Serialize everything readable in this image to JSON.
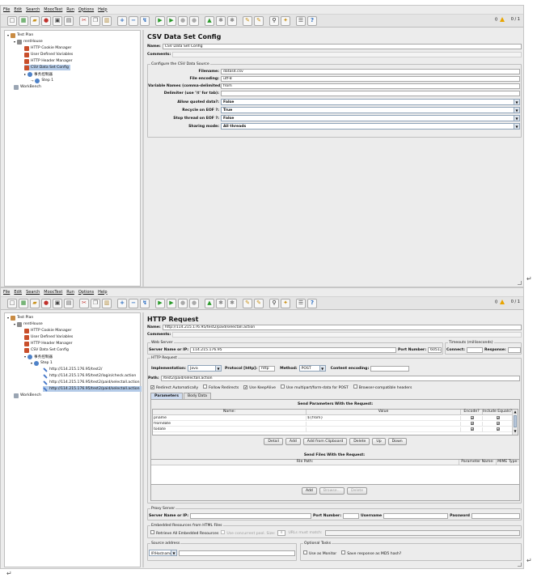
{
  "menu": [
    "File",
    "Edit",
    "Search",
    "MoocTest",
    "Run",
    "Options",
    "Help"
  ],
  "toolbar": {
    "warn_count": "0",
    "threads": "0 / 1"
  },
  "top": {
    "tree": {
      "test_plan": "Test Plan",
      "thread_group": "rentHouse",
      "cookie": "HTTP Cookie Manager",
      "udv": "User Defined Variables",
      "header": "HTTP Header Manager",
      "csv": "CSV Data Set Config",
      "ctrl": "事务控制器",
      "step": "Step 1",
      "workbench": "WorkBench"
    },
    "panel": {
      "title": "CSV Data Set Config",
      "name_label": "Name:",
      "name_value": "CSV Data Set Config",
      "comments_label": "Comments:",
      "group_title": "Configure the CSV Data Source",
      "fields": [
        {
          "label": "Filename:",
          "value": "datas4.csv"
        },
        {
          "label": "File encoding:",
          "value": "utf-8"
        },
        {
          "label": "Variable Names (comma-delimited):",
          "value": "from"
        },
        {
          "label": "Delimiter (use '\\t' for tab):",
          "value": ""
        }
      ],
      "selects": [
        {
          "label": "Allow quoted data?:",
          "value": "False"
        },
        {
          "label": "Recycle on EOF ?:",
          "value": "True"
        },
        {
          "label": "Stop thread on EOF ?:",
          "value": "False"
        },
        {
          "label": "Sharing mode:",
          "value": "All threads"
        }
      ]
    }
  },
  "bottom": {
    "tree": {
      "test_plan": "Test Plan",
      "thread_group": "rentHouse",
      "cookie": "HTTP Cookie Manager",
      "udv": "User Defined Variables",
      "header": "HTTP Header Manager",
      "csv": "CSV Data Set Config",
      "ctrl": "事务控制器",
      "step": "Step 1",
      "samplers": [
        "http://114.215.176.95/test2/",
        "http://114.215.176.95/test2/login/check.action",
        "http://114.215.176.95/test2/paid/selectall.action",
        "http://114.215.176.95/test2/paid/selectall.action"
      ],
      "workbench": "WorkBench"
    },
    "panel": {
      "title": "HTTP Request",
      "name_label": "Name:",
      "name_value": "http://114.215.176.95/test2/paid/selectall.action",
      "comments_label": "Comments:",
      "web_server_title": "Web Server",
      "server_label": "Server Name or IP:",
      "server_value": "114.215.176.95",
      "port_label": "Port Number:",
      "port_value": "60513",
      "timeouts_title": "Timeouts (milliseconds)",
      "connect_label": "Connect:",
      "response_label": "Response:",
      "http_request_title": "HTTP Request",
      "impl_label": "Implementation:",
      "impl_value": "Java",
      "protocol_label": "Protocol [http]:",
      "protocol_value": "http",
      "method_label": "Method:",
      "method_value": "POST",
      "encoding_label": "Content encoding:",
      "path_label": "Path:",
      "path_value": "/test2/paid/selectall.action",
      "checkboxes": [
        {
          "label": "Redirect Automatically",
          "checked": "✔"
        },
        {
          "label": "Follow Redirects",
          "checked": ""
        },
        {
          "label": "Use KeepAlive",
          "checked": "✔"
        },
        {
          "label": "Use multipart/form-data for POST",
          "checked": ""
        },
        {
          "label": "Browser-compatible headers",
          "checked": ""
        }
      ],
      "tabs": [
        "Parameters",
        "Body Data"
      ],
      "params_title": "Send Parameters With the Request:",
      "params_headers": [
        "Name:",
        "Value",
        "Encode?",
        "Include Equals?"
      ],
      "params_rows": [
        {
          "name": "pname",
          "value": "${from}",
          "encode": "✔",
          "equals": "✔"
        },
        {
          "name": "fromdate",
          "value": "",
          "encode": "✔",
          "equals": "✔"
        },
        {
          "name": "todate",
          "value": "",
          "encode": "✔",
          "equals": "✔"
        }
      ],
      "param_buttons": [
        "Detail",
        "Add",
        "Add from Clipboard",
        "Delete",
        "Up",
        "Down"
      ],
      "files_title": "Send Files With the Request:",
      "files_headers": [
        "File Path:",
        "Parameter Name:",
        "MIME Type:"
      ],
      "file_buttons": [
        "Add",
        "Browse...",
        "Delete"
      ],
      "proxy_title": "Proxy Server",
      "proxy_server_label": "Server Name or IP:",
      "proxy_port_label": "Port Number:",
      "proxy_user_label": "Username",
      "proxy_pass_label": "Password",
      "embedded_title": "Embedded Resources from HTML Files",
      "embedded_retrieve": "Retrieve All Embedded Resources",
      "embedded_pool": "Use concurrent pool. Size:",
      "embedded_pool_size": "4",
      "embedded_urls": "URLs must match:",
      "source_title": "Source address",
      "source_type": "IP/Hostname",
      "optional_title": "Optional Tasks",
      "opt_monitor": "Use as Monitor",
      "opt_md5": "Save response as MD5 hash?"
    }
  },
  "return_symbol": "↵"
}
